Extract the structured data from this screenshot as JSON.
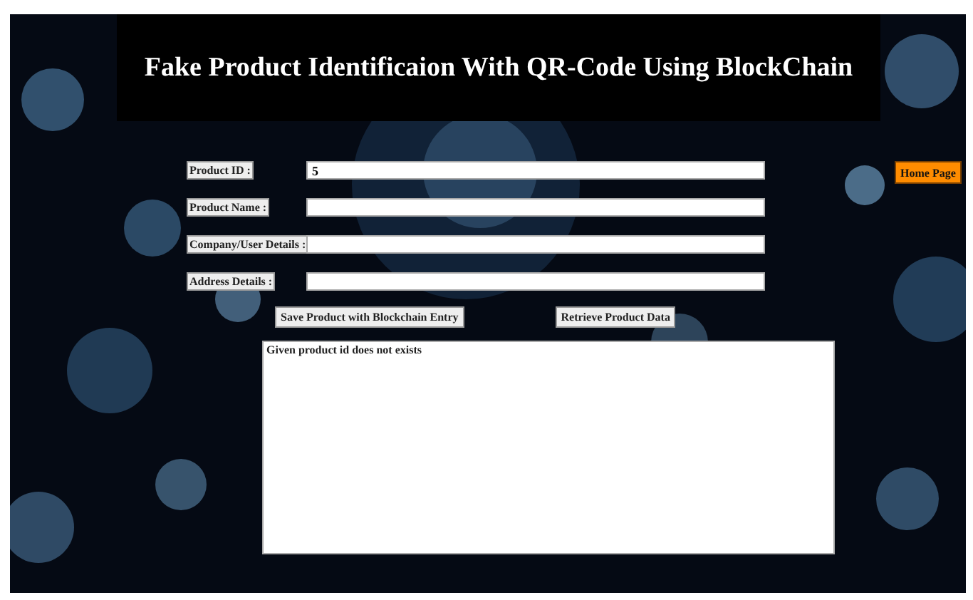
{
  "header": {
    "title": "Fake Product Identificaion With QR-Code Using BlockChain"
  },
  "fields": [
    {
      "label": "Product ID :",
      "value": "5"
    },
    {
      "label": "Product Name :"
    },
    {
      "label": "Company/User Details :"
    },
    {
      "label": "Address Details :"
    }
  ],
  "buttons": [
    {
      "label": "Save Product with Blockchain Entry"
    },
    {
      "label": "Retrieve Product Data"
    }
  ],
  "output": {
    "value": "Given product id does not exists"
  },
  "home_button": {
    "label": "Home Page"
  }
}
